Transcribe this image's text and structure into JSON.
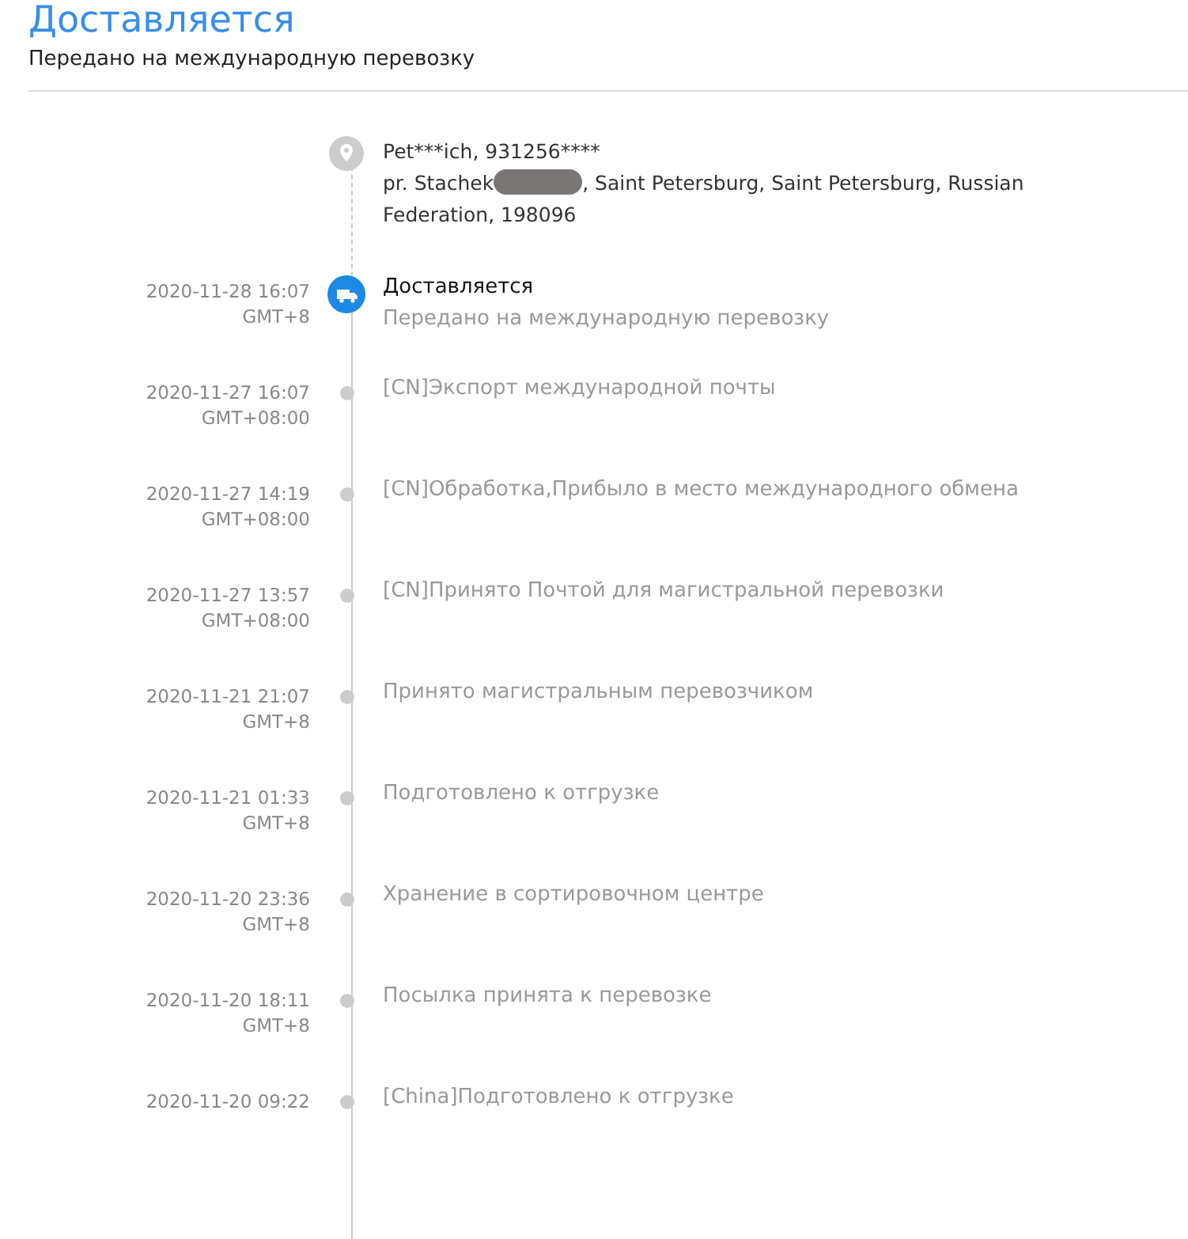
{
  "header": {
    "status": "Доставляется",
    "detail": "Передано на международную перевозку"
  },
  "address": {
    "name_phone": "Pet***ich,  931256****",
    "street": "pr. Stachek",
    "rest": ",  Saint Petersburg,  Saint Petersburg,  Russian",
    "last_line": "Federation,  198096",
    "redacted": true
  },
  "events": [
    {
      "kind": "current",
      "time": "2020-11-28 16:07",
      "tz": "GMT+8",
      "title": "Доставляется",
      "detail": "Передано на международную перевозку"
    },
    {
      "kind": "past",
      "time": "2020-11-27 16:07",
      "tz": "GMT+08:00",
      "title": "[CN]Экспорт международной почты"
    },
    {
      "kind": "past",
      "time": "2020-11-27 14:19",
      "tz": "GMT+08:00",
      "title": "[CN]Обработка,Прибыло в место международного обмена"
    },
    {
      "kind": "past",
      "time": "2020-11-27 13:57",
      "tz": "GMT+08:00",
      "title": "[CN]Принято Почтой для магистральной перевозки"
    },
    {
      "kind": "past",
      "time": "2020-11-21 21:07",
      "tz": "GMT+8",
      "title": "Принято магистральным перевозчиком"
    },
    {
      "kind": "past",
      "time": "2020-11-21 01:33",
      "tz": "GMT+8",
      "title": "Подготовлено к отгрузке"
    },
    {
      "kind": "past",
      "time": "2020-11-20 23:36",
      "tz": "GMT+8",
      "title": "Хранение в сортировочном центре"
    },
    {
      "kind": "past",
      "time": "2020-11-20 18:11",
      "tz": "GMT+8",
      "title": "Посылка принята к перевозке"
    },
    {
      "kind": "past",
      "time": "2020-11-20 09:22",
      "title": "[China]Подготовлено к отгрузке"
    }
  ]
}
